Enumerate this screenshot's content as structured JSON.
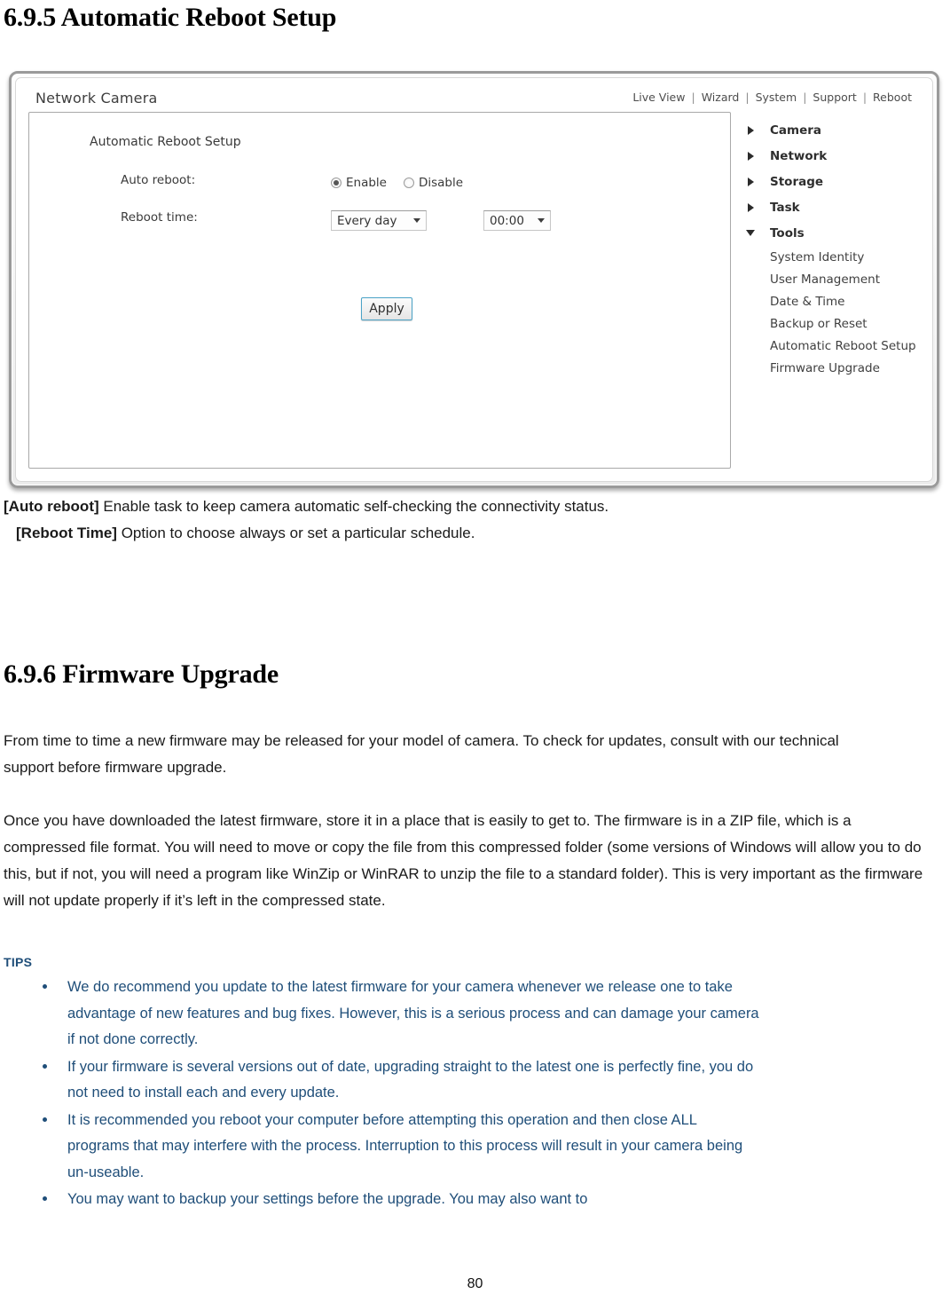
{
  "headings": {
    "section_695": "6.9.5 Automatic Reboot Setup",
    "section_696": "6.9.6 Firmware Upgrade"
  },
  "screenshot": {
    "browser_title": "Network Camera",
    "topnav": {
      "items": [
        "Live View",
        "Wizard",
        "System",
        "Support",
        "Reboot"
      ],
      "separator": "|"
    },
    "panel": {
      "title": "Automatic Reboot Setup",
      "rows": [
        {
          "label": "Auto reboot:",
          "options": [
            {
              "label": "Enable",
              "selected": true
            },
            {
              "label": "Disable",
              "selected": false
            }
          ]
        },
        {
          "label": "Reboot time:",
          "day_select_value": "Every day",
          "time_select_value": "00:00"
        }
      ],
      "apply_label": "Apply"
    },
    "sidebar": {
      "top_items": [
        {
          "label": "Camera",
          "expanded": false
        },
        {
          "label": "Network",
          "expanded": false
        },
        {
          "label": "Storage",
          "expanded": false
        },
        {
          "label": "Task",
          "expanded": false
        },
        {
          "label": "Tools",
          "expanded": true
        }
      ],
      "tools_sub_items": [
        "System Identity",
        "User Management",
        "Date & Time",
        "Backup or Reset",
        "Automatic Reboot Setup",
        "Firmware Upgrade"
      ]
    }
  },
  "definitions": [
    {
      "term": "[Auto reboot]",
      "text": " Enable task to keep camera automatic self-checking the connectivity status."
    },
    {
      "term": "[Reboot Time]",
      "text": " Option to choose always or set a particular schedule."
    }
  ],
  "paragraphs": {
    "p1": "From time to time a new firmware may be released for your model of camera. To check for updates, consult with our technical support before firmware upgrade.",
    "p2": "Once you have downloaded the latest firmware, store it in a place that is easily to get to. The firmware is in a ZIP file, which is a compressed file format. You will need to move or copy the file from this compressed folder (some versions of Windows will allow you to do this, but if not, you will need a program like WinZip or WinRAR to unzip the file to a standard folder). This is very important as the firmware will not update properly if it’s left in the compressed state."
  },
  "tips": {
    "label": "TIPS",
    "color": "#1F4E79",
    "items": [
      "We do recommend you update to the latest firmware for your camera whenever we release one to take advantage of new features and bug fixes. However, this is a serious process and can damage your camera if not done correctly.",
      "If your firmware is several versions out of date, upgrading straight to the latest one is perfectly fine, you do not need to install each and every update.",
      "It is recommended you reboot your computer before attempting this operation and then close ALL programs that may interfere with the process. Interruption to this process will result in your camera being un-useable.",
      "You may want to backup your settings before the upgrade. You may also want to"
    ]
  },
  "footer": {
    "page_number": "80"
  }
}
